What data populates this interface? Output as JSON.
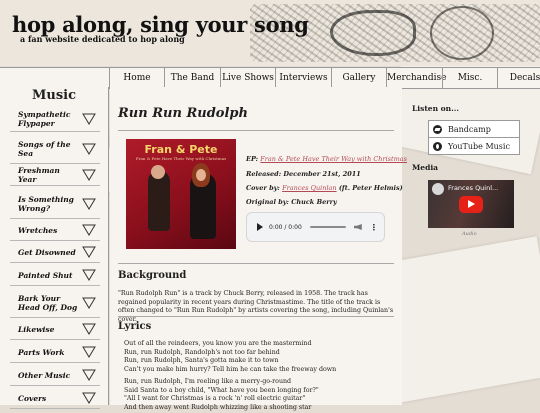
{
  "site": {
    "title": "hop along, sing your song",
    "tagline": "a fan website dedicated to hop along"
  },
  "nav": [
    "Home",
    "The Band",
    "Live Shows",
    "Interviews",
    "Gallery",
    "Merchandise",
    "Misc.",
    "Decals"
  ],
  "sidebar": {
    "heading": "Music",
    "items": [
      "Sympathetic Flypaper",
      "Songs of the Sea",
      "Freshman Year",
      "Is Something Wrong?",
      "Wretches",
      "Get Disowned",
      "Painted Shut",
      "Bark Your Head Off, Dog",
      "Likewise",
      "Parts Work",
      "Other Music",
      "Covers"
    ]
  },
  "song": {
    "title": "Run Run Rudolph",
    "cover_title": "Fran & Pete",
    "cover_subtitle": "Fran & Pete Have Their Way with Christmas",
    "ep_label": "EP: ",
    "ep_link": "Fran & Pete Have Their Way with Christmas",
    "released": "Released: December 21st, 2011",
    "cover_by_label": "Cover by: ",
    "cover_by_link": "Frances Quinlan",
    "cover_by_extra": " (ft. Peter Helmis)",
    "original_by": "Original by: Chuck Berry"
  },
  "audio": {
    "time": "0:00 / 0:00"
  },
  "background": {
    "heading": "Background",
    "text": "\"Run Rudolph Run\" is a track by Chuck Berry, released in 1958. The track has regained popularity in recent years during Christmastime. The title of the track is often changed to \"Run Run Rudolph\" by artists covering the song, including Quinlan's cover."
  },
  "lyrics": {
    "heading": "Lyrics",
    "stanza1": "Out of all the reindeers, you know you are the mastermind\nRun, run Rudolph, Randolph's not too far behind\nRun, run Rudolph, Santa's gotta make it to town\nCan't you make him hurry? Tell him he can take the freeway down",
    "stanza2": "Run, run Rudolph, I'm reeling like a merry-go-round\nSaid Santa to a boy child, \"What have you been longing for?\"\n\"All I want for Christmas is a rock 'n' roll electric guitar\"\nAnd then away went Rudolph whizzing like a shooting star"
  },
  "right": {
    "listen_heading": "Listen on...",
    "listen": [
      "Bandcamp",
      "YouTube Music"
    ],
    "media_heading": "Media",
    "video_title": "Frances Quinl...",
    "video_caption": "Audio"
  }
}
